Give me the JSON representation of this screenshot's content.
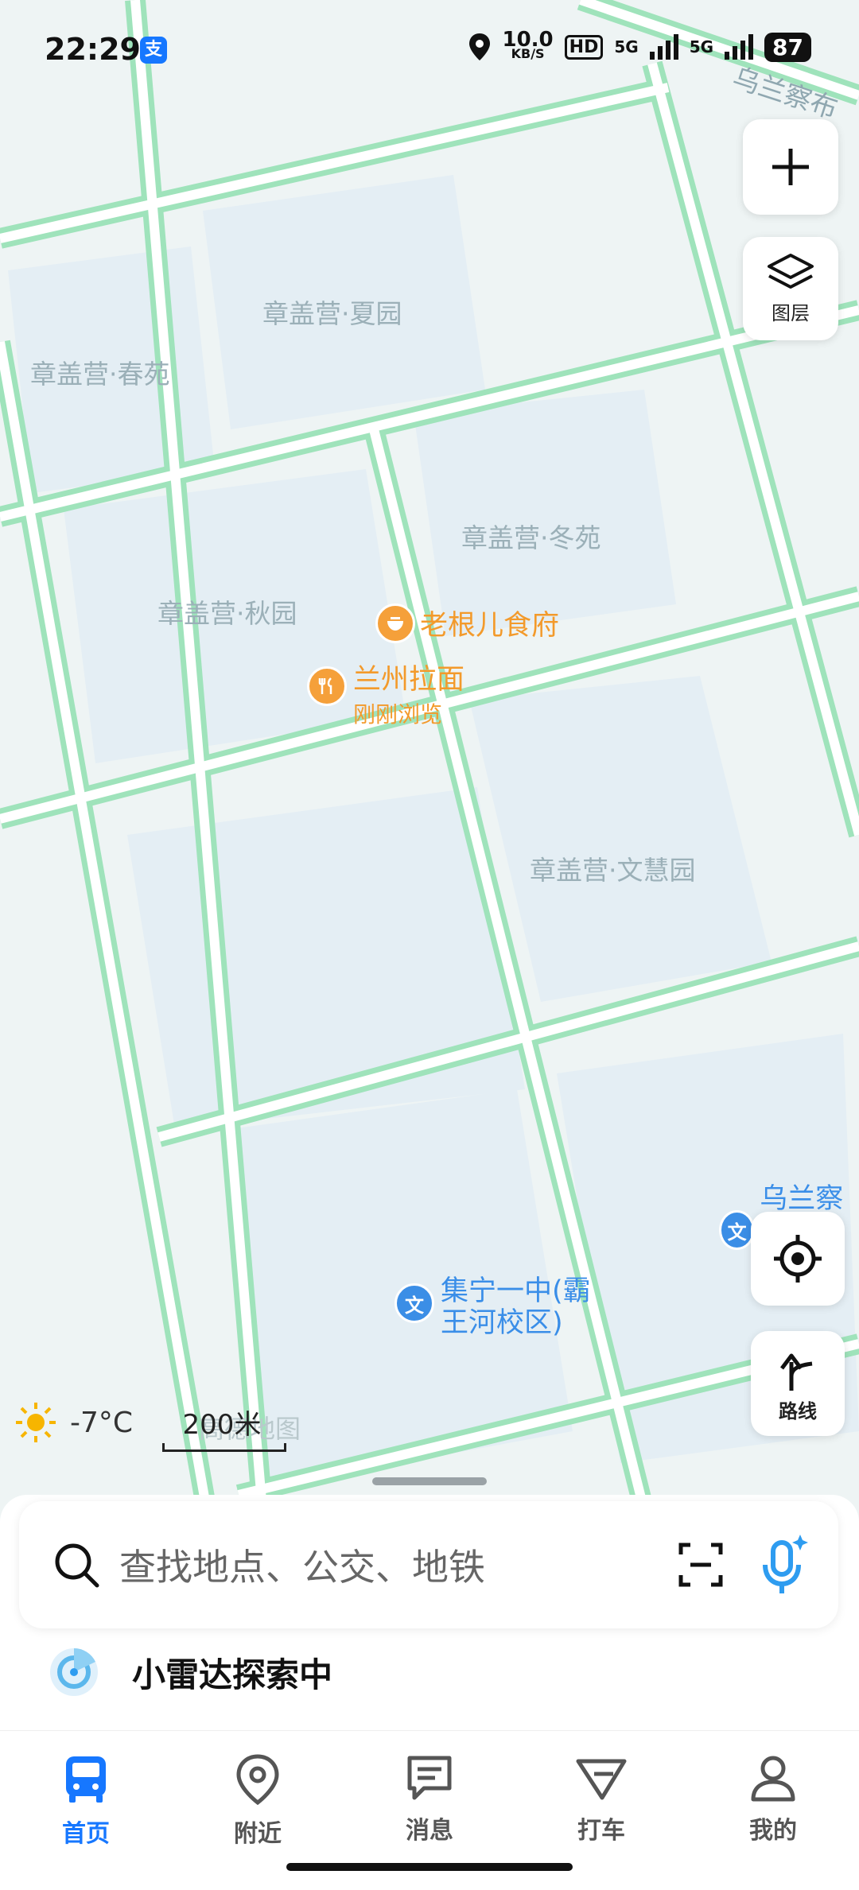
{
  "status_bar": {
    "time": "22:29",
    "net_speed_value": "10.0",
    "net_speed_unit": "KB/S",
    "hd": "HD",
    "signal1": "5G",
    "signal2": "5G",
    "battery": "87"
  },
  "map": {
    "street_label": "乌兰察布",
    "places": [
      "章盖营·夏园",
      "章盖营·春苑",
      "章盖营·冬苑",
      "章盖营·秋园",
      "章盖营·文慧园"
    ],
    "poi_food1": "老根儿食府",
    "poi_food2": "兰州拉面",
    "poi_food2_sub": "刚刚浏览",
    "school_line1": "集宁一中(霸",
    "school_line2": "王河校区)",
    "school_right": "乌兰察布",
    "school_icon": "文"
  },
  "controls": {
    "layers_label": "图层",
    "route_label": "路线"
  },
  "weather": {
    "temp": "-7°C"
  },
  "scale": {
    "label": "200米"
  },
  "watermark": "高德地图",
  "search": {
    "placeholder": "查找地点、公交、地铁"
  },
  "radar": {
    "label": "小雷达探索中"
  },
  "nav": [
    {
      "label": "首页",
      "active": true
    },
    {
      "label": "附近"
    },
    {
      "label": "消息"
    },
    {
      "label": "打车"
    },
    {
      "label": "我的"
    }
  ],
  "colors": {
    "accent": "#1677ff",
    "road": "#8fe0b0",
    "poi_orange": "#f39a2b",
    "poi_blue": "#3b8ee6"
  }
}
